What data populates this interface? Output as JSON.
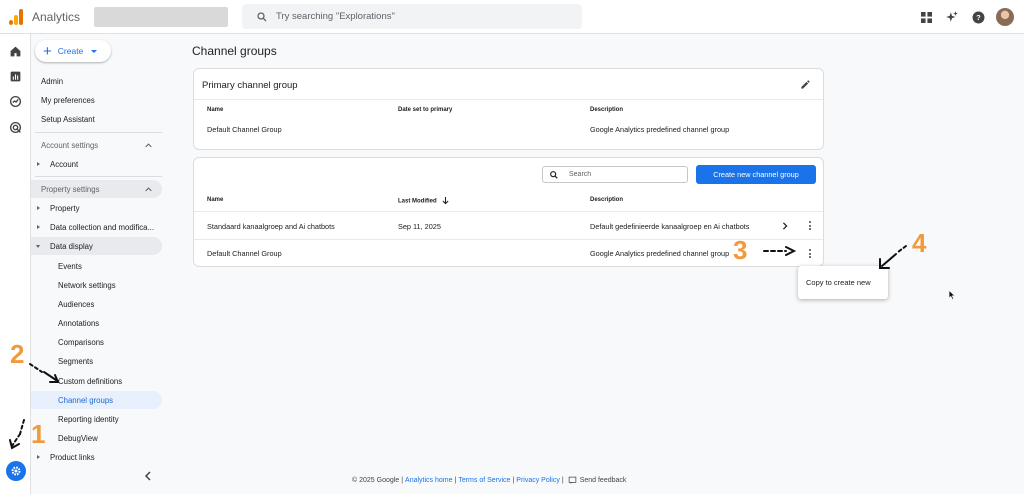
{
  "app": {
    "title": "Analytics"
  },
  "search": {
    "placeholder": "Try searching \"Explorations\""
  },
  "sidebar": {
    "create_label": "Create",
    "items": {
      "admin": "Admin",
      "preferences": "My preferences",
      "setup": "Setup Assistant",
      "account_settings": "Account settings",
      "account": "Account",
      "property_settings": "Property settings",
      "property": "Property",
      "data_collection": "Data collection and modifica...",
      "data_display": "Data display",
      "events": "Events",
      "network": "Network settings",
      "audiences": "Audiences",
      "annotations": "Annotations",
      "comparisons": "Comparisons",
      "segments": "Segments",
      "custom_definitions": "Custom definitions",
      "channel_groups": "Channel groups",
      "reporting_identity": "Reporting identity",
      "debugview": "DebugView",
      "product_links": "Product links"
    }
  },
  "main": {
    "page_title": "Channel groups",
    "primary_card": {
      "title": "Primary channel group",
      "headers": {
        "name": "Name",
        "date": "Date set to primary",
        "description": "Description"
      },
      "row": {
        "name": "Default Channel Group",
        "date": "",
        "description": "Google Analytics predefined channel group"
      }
    },
    "table": {
      "search_placeholder": "Search",
      "create_button": "Create new channel group",
      "headers": {
        "name": "Name",
        "modified": "Last Modified",
        "description": "Description"
      },
      "rows": [
        {
          "name": "Standaard kanaalgroep and Ai chatbots",
          "modified": "Sep 11, 2025",
          "description": "Default gedefinieerde kanaalgroep en Ai chatbots"
        },
        {
          "name": "Default Channel Group",
          "modified": "",
          "description": "Google Analytics predefined channel group"
        }
      ]
    },
    "menu": {
      "copy": "Copy to create new"
    }
  },
  "annotations": {
    "one": "1",
    "two": "2",
    "three": "3",
    "four": "4"
  },
  "footer": {
    "copyright": "© 2025 Google",
    "home": "Analytics home",
    "terms": "Terms of Service",
    "privacy": "Privacy Policy",
    "feedback": "Send feedback"
  },
  "colors": {
    "accent": "#1a73e8",
    "annotation": "#f29a3b"
  }
}
